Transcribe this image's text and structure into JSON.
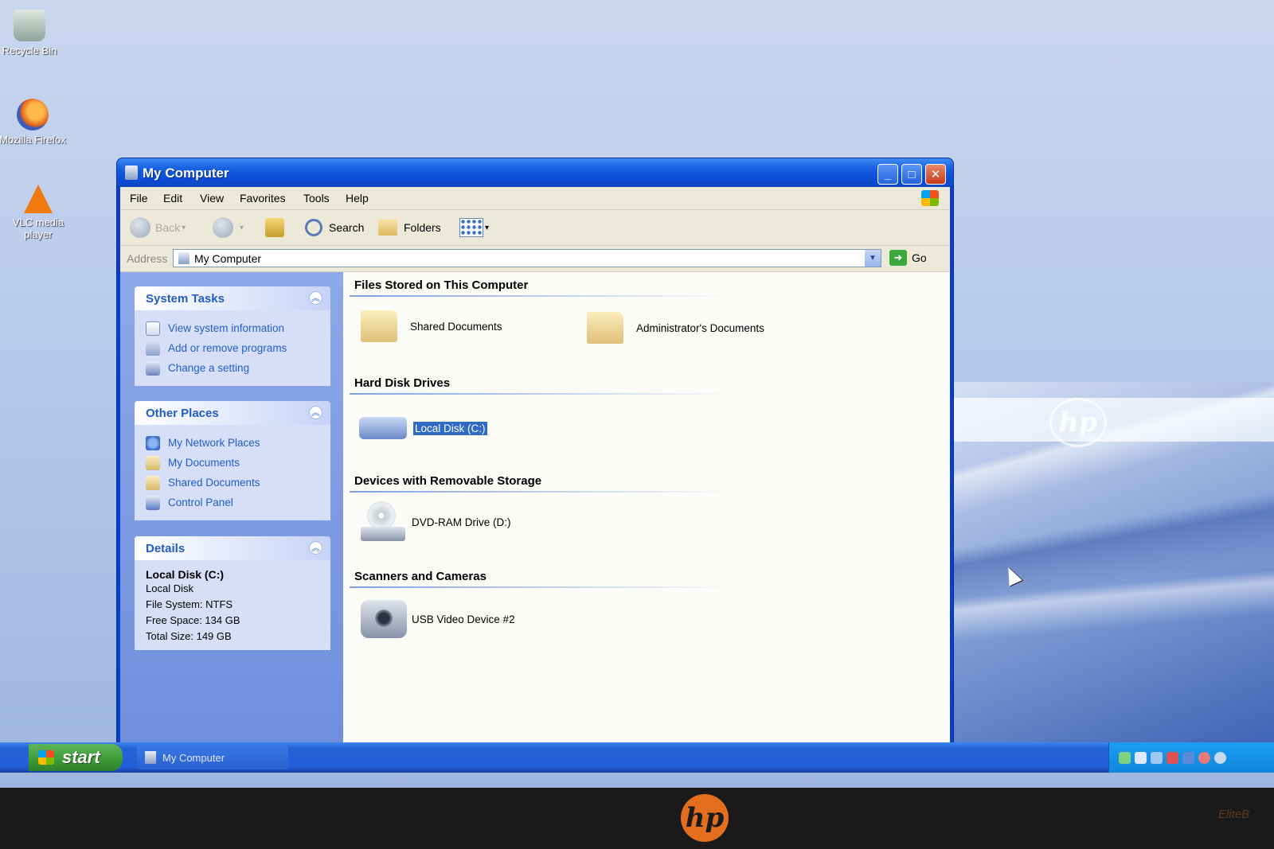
{
  "desktop": {
    "icons": [
      {
        "label": "Recycle Bin"
      },
      {
        "label": "Mozilla Firefox"
      },
      {
        "label": "VLC media player"
      }
    ],
    "wallpaper_logo": "hp"
  },
  "window": {
    "title": "My Computer",
    "controls": {
      "minimize": "_",
      "maximize": "□",
      "close": "✕"
    },
    "menu": [
      "File",
      "Edit",
      "View",
      "Favorites",
      "Tools",
      "Help"
    ],
    "toolbar": {
      "back": "Back",
      "search": "Search",
      "folders": "Folders"
    },
    "address": {
      "label": "Address",
      "value": "My Computer",
      "go": "Go"
    },
    "taskpane": {
      "system_tasks": {
        "title": "System Tasks",
        "items": [
          "View system information",
          "Add or remove programs",
          "Change a setting"
        ]
      },
      "other_places": {
        "title": "Other Places",
        "items": [
          "My Network Places",
          "My Documents",
          "Shared Documents",
          "Control Panel"
        ]
      },
      "details": {
        "title": "Details",
        "name": "Local Disk (C:)",
        "type": "Local Disk",
        "file_system": "File System: NTFS",
        "free_space": "Free Space: 134 GB",
        "total_size": "Total Size: 149 GB"
      }
    },
    "content": {
      "groups": [
        {
          "header": "Files Stored on This Computer",
          "items": [
            "Shared Documents",
            "Administrator's Documents"
          ]
        },
        {
          "header": "Hard Disk Drives",
          "items": [
            "Local Disk (C:)"
          ]
        },
        {
          "header": "Devices with Removable Storage",
          "items": [
            "DVD-RAM Drive (D:)"
          ]
        },
        {
          "header": "Scanners and Cameras",
          "items": [
            "USB Video Device #2"
          ]
        }
      ]
    }
  },
  "taskbar": {
    "start": "start",
    "tasks": [
      "My Computer"
    ]
  },
  "bezel": {
    "logo": "hp",
    "brand": "EliteB"
  },
  "colors": {
    "xp_title_blue": "#0a4fd6",
    "task_link_blue": "#215dc6",
    "selection_blue": "#316ac5",
    "start_green": "#3c9a36"
  }
}
